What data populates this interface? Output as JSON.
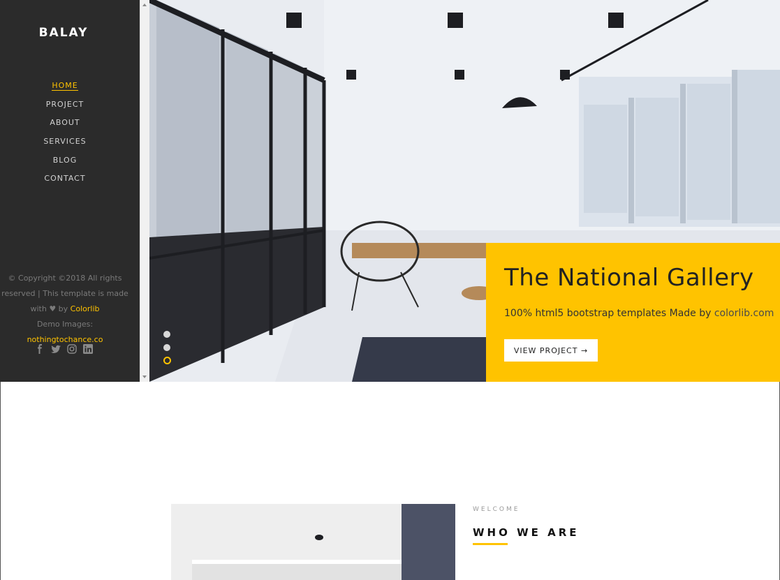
{
  "sidebar": {
    "brand": "BALAY",
    "nav": [
      "HOME",
      "PROJECT",
      "ABOUT",
      "SERVICES",
      "BLOG",
      "CONTACT"
    ],
    "active_index": 0,
    "copyright_line1": "© Copyright ©2018 All rights",
    "copyright_line2": "reserved | This template is made",
    "copyright_line3_prefix": "with ♥ by ",
    "copyright_line3_link": "Colorlib",
    "copyright_line4_prefix": "Demo Images: ",
    "copyright_line4_link": "nothingtochance.co",
    "social_icons": [
      "facebook-icon",
      "twitter-icon",
      "instagram-icon",
      "linkedin-icon"
    ]
  },
  "hero": {
    "title": "The National Gallery",
    "subtitle_prefix": "100% html5 bootstrap templates Made by ",
    "subtitle_link": "colorlib.com",
    "button": "VIEW PROJECT →",
    "slides": 3,
    "active_slide": 2
  },
  "welcome": {
    "label": "WELCOME",
    "title": "WHO WE ARE"
  },
  "colors": {
    "accent": "#ffc300",
    "sidebar_bg": "#2b2b2b"
  }
}
